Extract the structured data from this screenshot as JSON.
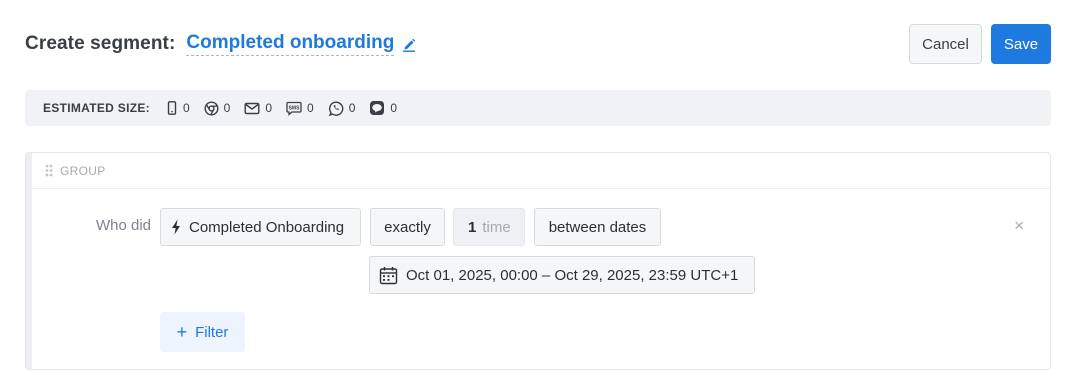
{
  "header": {
    "title_label": "Create segment:",
    "segment_name": "Completed onboarding",
    "cancel_label": "Cancel",
    "save_label": "Save"
  },
  "estimated_size": {
    "label": "ESTIMATED SIZE:",
    "channels": [
      {
        "icon": "mobile-icon",
        "count": "0"
      },
      {
        "icon": "chrome-icon",
        "count": "0"
      },
      {
        "icon": "email-icon",
        "count": "0"
      },
      {
        "icon": "sms-icon",
        "count": "0"
      },
      {
        "icon": "whatsapp-icon",
        "count": "0"
      },
      {
        "icon": "line-icon",
        "count": "0"
      }
    ]
  },
  "group": {
    "label": "GROUP",
    "condition": {
      "prefix": "Who did",
      "event": "Completed Onboarding",
      "operator": "exactly",
      "count": "1",
      "count_unit": "time",
      "range_type": "between dates",
      "date_range": "Oct 01, 2025, 00:00 – Oct 29, 2025, 23:59 UTC+1"
    },
    "remove_symbol": "×",
    "filter_label": "Filter",
    "filter_plus": "+"
  },
  "colors": {
    "accent": "#1f7ae0",
    "text": "#2b2f36",
    "muted": "#a5aab2",
    "bar_bg": "#f1f2f5"
  }
}
